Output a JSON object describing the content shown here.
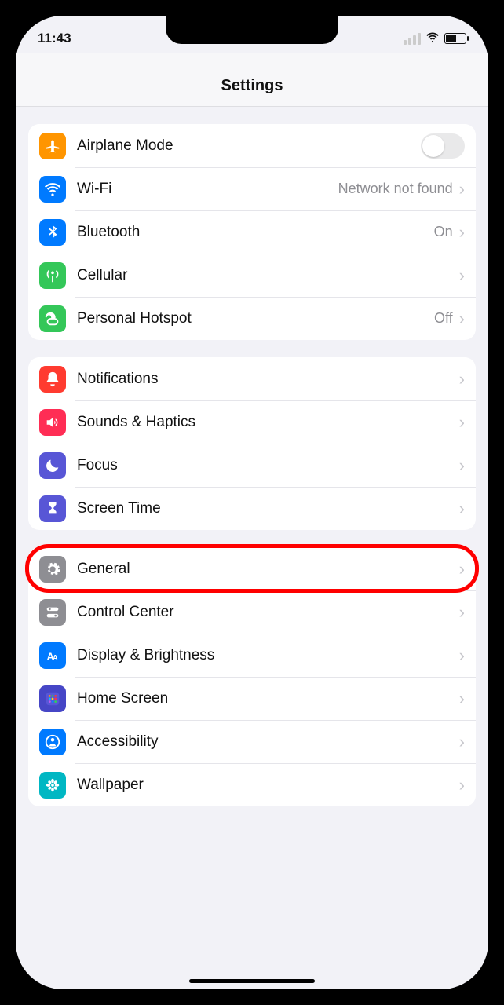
{
  "status": {
    "time": "11:43"
  },
  "header": {
    "title": "Settings"
  },
  "groups": [
    {
      "rows": [
        {
          "id": "airplane-mode",
          "label": "Airplane Mode",
          "type": "switch",
          "value_on": false,
          "icon": "airplane",
          "bg": "bg-orange"
        },
        {
          "id": "wifi",
          "label": "Wi-Fi",
          "type": "link",
          "detail": "Network not found",
          "icon": "wifi",
          "bg": "bg-blue"
        },
        {
          "id": "bluetooth",
          "label": "Bluetooth",
          "type": "link",
          "detail": "On",
          "icon": "bluetooth",
          "bg": "bg-blue"
        },
        {
          "id": "cellular",
          "label": "Cellular",
          "type": "link",
          "detail": "",
          "icon": "antenna",
          "bg": "bg-green"
        },
        {
          "id": "hotspot",
          "label": "Personal Hotspot",
          "type": "link",
          "detail": "Off",
          "icon": "hotspot",
          "bg": "bg-green"
        }
      ]
    },
    {
      "rows": [
        {
          "id": "notifications",
          "label": "Notifications",
          "type": "link",
          "detail": "",
          "icon": "bell",
          "bg": "bg-red"
        },
        {
          "id": "sounds",
          "label": "Sounds & Haptics",
          "type": "link",
          "detail": "",
          "icon": "speaker",
          "bg": "bg-pink"
        },
        {
          "id": "focus",
          "label": "Focus",
          "type": "link",
          "detail": "",
          "icon": "moon",
          "bg": "bg-indigo"
        },
        {
          "id": "screentime",
          "label": "Screen Time",
          "type": "link",
          "detail": "",
          "icon": "hourglass",
          "bg": "bg-indigo"
        }
      ]
    },
    {
      "rows": [
        {
          "id": "general",
          "label": "General",
          "type": "link",
          "detail": "",
          "icon": "gear",
          "bg": "bg-gray",
          "highlighted": true
        },
        {
          "id": "control-center",
          "label": "Control Center",
          "type": "link",
          "detail": "",
          "icon": "switches",
          "bg": "bg-gray"
        },
        {
          "id": "display",
          "label": "Display & Brightness",
          "type": "link",
          "detail": "",
          "icon": "text-size",
          "bg": "bg-blue"
        },
        {
          "id": "home-screen",
          "label": "Home Screen",
          "type": "link",
          "detail": "",
          "icon": "grid",
          "bg": "bg-darkblue"
        },
        {
          "id": "accessibility",
          "label": "Accessibility",
          "type": "link",
          "detail": "",
          "icon": "person",
          "bg": "bg-blue"
        },
        {
          "id": "wallpaper",
          "label": "Wallpaper",
          "type": "link",
          "detail": "",
          "icon": "flower",
          "bg": "bg-teal"
        }
      ]
    }
  ]
}
